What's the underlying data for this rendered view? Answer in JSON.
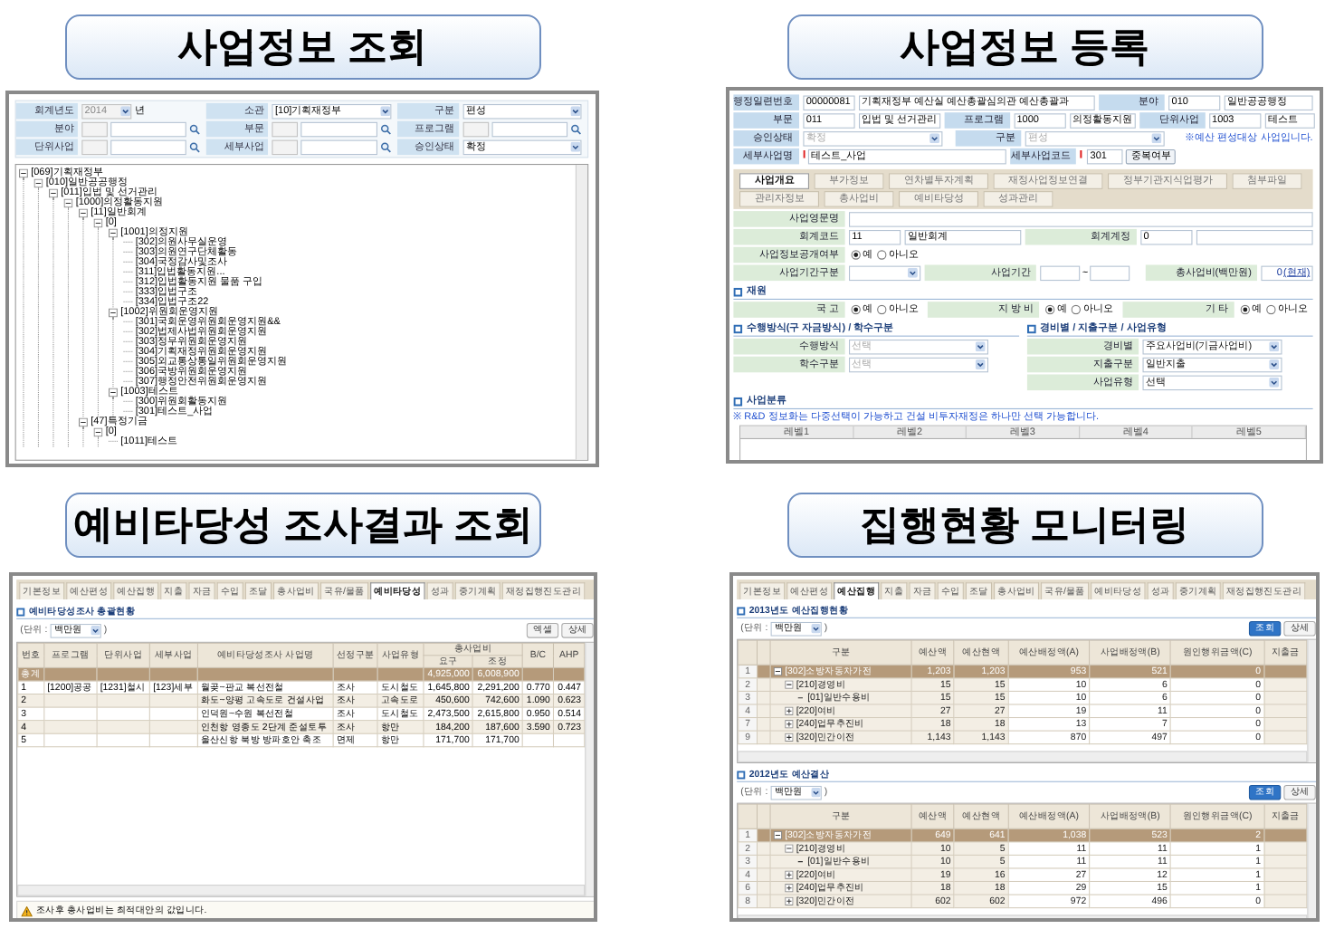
{
  "search_panel": {
    "title": "사업정보 조회",
    "fields": [
      {
        "kind": "year",
        "label": "회계년도",
        "value": "2014",
        "suffix": "년",
        "disabled": true
      },
      {
        "kind": "select",
        "label": "소관",
        "value": "[10]기획재정부"
      },
      {
        "kind": "select",
        "label": "구분",
        "value": "편성"
      },
      {
        "kind": "lookup",
        "label": "분야"
      },
      {
        "kind": "lookup",
        "label": "부문"
      },
      {
        "kind": "lookup",
        "label": "프로그램"
      },
      {
        "kind": "lookup",
        "label": "단위사업"
      },
      {
        "kind": "lookup",
        "label": "세부사업"
      },
      {
        "kind": "select",
        "label": "승인상태",
        "value": "확정"
      }
    ],
    "tree": [
      {
        "label": "[069]기획재정부",
        "children": [
          {
            "label": "[010]일반공공행정",
            "children": [
              {
                "label": "[011]입법 및 선거관리",
                "children": [
                  {
                    "label": "[1000]의정활동지원",
                    "children": [
                      {
                        "label": "[11]일반회계",
                        "children": [
                          {
                            "label": "[0]",
                            "children": [
                              {
                                "label": "[1001]의정지원",
                                "children": [
                                  {
                                    "label": "[302]의원사무실운영"
                                  },
                                  {
                                    "label": "[303]의원연구단체활동"
                                  },
                                  {
                                    "label": "[304]국정감사및조사"
                                  },
                                  {
                                    "label": "[311]입법활동지원..."
                                  },
                                  {
                                    "label": "[312]입법활동지원 물품 구입"
                                  },
                                  {
                                    "label": "[333]입법구조"
                                  },
                                  {
                                    "label": "[334]입법구조22"
                                  }
                                ]
                              },
                              {
                                "label": "[1002]위원회운영지원",
                                "children": [
                                  {
                                    "label": "[301]국회운영위원회운영지원&&"
                                  },
                                  {
                                    "label": "[302]법제사법위원회운영지원"
                                  },
                                  {
                                    "label": "[303]정무위원회운영지원"
                                  },
                                  {
                                    "label": "[304]기획재정위원회운영지원"
                                  },
                                  {
                                    "label": "[305]외교통상통일위원회운영지원"
                                  },
                                  {
                                    "label": "[306]국방위원회운영지원"
                                  },
                                  {
                                    "label": "[307]행정안전위원회운영지원"
                                  }
                                ]
                              },
                              {
                                "label": "[1003]테스트",
                                "children": [
                                  {
                                    "label": "[300]위원회활동지원"
                                  },
                                  {
                                    "label": "[301]테스트_사업"
                                  }
                                ]
                              }
                            ]
                          }
                        ]
                      },
                      {
                        "label": "[47]특정기금",
                        "children": [
                          {
                            "label": "[0]",
                            "children": [
                              {
                                "label": "[1011]테스트"
                              }
                            ]
                          }
                        ]
                      }
                    ]
                  }
                ]
              }
            ]
          }
        ]
      }
    ]
  },
  "register_panel": {
    "title": "사업정보 등록",
    "header_rows": [
      [
        {
          "kind": "code",
          "label": "행정일련번호",
          "code": "00000081",
          "value": "기획재정부 예산실 예산총괄심의관 예산총괄과"
        },
        {
          "kind": "code",
          "label": "분야",
          "code": "010",
          "value": "일반공공행정"
        }
      ],
      [
        {
          "kind": "code",
          "label": "부문",
          "code": "011",
          "value": "입법 및 선거관리"
        },
        {
          "kind": "code",
          "label": "프로그램",
          "code": "1000",
          "value": "의정활동지원"
        },
        {
          "kind": "code",
          "label": "단위사업",
          "code": "1003",
          "value": "테스트"
        }
      ],
      [
        {
          "kind": "select",
          "label": "승인상태",
          "value": "확정",
          "disabled": true
        },
        {
          "kind": "select",
          "label": "구분",
          "value": "편성",
          "disabled": true
        },
        {
          "kind": "note",
          "value": "※예산 편성대상 사업입니다."
        }
      ],
      [
        {
          "kind": "text",
          "label": "세부사업명",
          "value": "테스트_사업",
          "required": true
        },
        {
          "kind": "code_button",
          "label": "세부사업코드",
          "code": "301",
          "button": "중복여부",
          "required": true
        }
      ]
    ],
    "tabs": [
      {
        "label": "사업개요",
        "selected": true
      },
      {
        "label": "부가정보",
        "selected": false
      },
      {
        "label": "연차별투자계획",
        "selected": false
      },
      {
        "label": "재정사업정보연결",
        "selected": false
      },
      {
        "label": "정부기관지식업평가",
        "selected": false
      },
      {
        "label": "첨부파일",
        "selected": false
      },
      {
        "label": "관리자정보",
        "selected": false
      },
      {
        "label": "총사업비",
        "selected": false
      },
      {
        "label": "예비타당성",
        "selected": false
      },
      {
        "label": "성과관리",
        "selected": false
      }
    ],
    "form_rows": [
      [
        {
          "kind": "text",
          "label": "사업영문명"
        }
      ],
      [
        {
          "kind": "code",
          "label": "회계코드",
          "code": "11",
          "value": "일반회계"
        },
        {
          "kind": "code",
          "label": "회계계정",
          "code": "0"
        }
      ],
      [
        {
          "kind": "radio",
          "label": "사업정보공개여부",
          "options": [
            {
              "label": "예",
              "selected": true
            },
            {
              "label": "아니오",
              "selected": false
            }
          ]
        }
      ],
      [
        {
          "kind": "select",
          "label": "사업기간구분"
        },
        {
          "kind": "range",
          "label": "사업기간",
          "separator": "~"
        },
        {
          "kind": "amount",
          "label": "총사업비(백만원)",
          "value": "0",
          "link": "(현재)"
        }
      ]
    ],
    "funding": {
      "title": "재원",
      "fields": [
        {
          "kind": "radio",
          "label": "국 고",
          "options": [
            {
              "label": "예",
              "selected": true
            },
            {
              "label": "아니오",
              "selected": false
            }
          ]
        },
        {
          "kind": "radio",
          "label": "지 방 비",
          "options": [
            {
              "label": "예",
              "selected": true
            },
            {
              "label": "아니오",
              "selected": false
            }
          ]
        },
        {
          "kind": "radio",
          "label": "기 타",
          "options": [
            {
              "label": "예",
              "selected": true
            },
            {
              "label": "아니오",
              "selected": false
            }
          ]
        }
      ]
    },
    "split_sections": [
      {
        "title": "수행방식(구 자금방식) / 학수구분",
        "fields": [
          {
            "kind": "select",
            "label": "수행방식",
            "value": "선택",
            "disabled": true
          },
          {
            "kind": "select",
            "label": "학수구분",
            "value": "선택",
            "disabled": true
          }
        ]
      },
      {
        "title": "경비별 / 지출구분 / 사업유형",
        "fields": [
          {
            "kind": "select",
            "label": "경비별",
            "value": "주요사업비(기금사업비)",
            "disabled": false
          },
          {
            "kind": "select",
            "label": "지출구분",
            "value": "일반지출",
            "disabled": false
          },
          {
            "kind": "select",
            "label": "사업유형",
            "value": "선택",
            "disabled": false
          }
        ]
      }
    ],
    "classification": {
      "title": "사업분류",
      "note": "※ R&D 정보화는 다중선택이 가능하고 건설 비투자재정은 하나만 선택 가능합니다.",
      "columns": [
        "레벨1",
        "레벨2",
        "레벨3",
        "레벨4",
        "레벨5"
      ]
    }
  },
  "feasibility_panel": {
    "title": "예비타당성 조사결과 조회",
    "tabs": [
      {
        "label": "기본정보",
        "selected": false
      },
      {
        "label": "예산편성",
        "selected": false
      },
      {
        "label": "예산집행",
        "selected": false
      },
      {
        "label": "지출",
        "selected": false
      },
      {
        "label": "자금",
        "selected": false
      },
      {
        "label": "수입",
        "selected": false
      },
      {
        "label": "조달",
        "selected": false
      },
      {
        "label": "총사업비",
        "selected": false
      },
      {
        "label": "국유/물품",
        "selected": false
      },
      {
        "label": "예비타당성",
        "selected": true
      },
      {
        "label": "성과",
        "selected": false
      },
      {
        "label": "중기계획",
        "selected": false
      },
      {
        "label": "재정집행진도관리",
        "selected": false
      }
    ],
    "section_title": "예비타당성조사 총괄현황",
    "unit_open": "(단위 :",
    "unit": "백만원",
    "unit_close": ")",
    "buttons": [
      "엑셀",
      "상세"
    ],
    "columns": [
      "번호",
      "프로그램",
      "단위사업",
      "세부사업",
      "예비타당성조사 사업명",
      "선정구분",
      "사업유형",
      "총사업비",
      "B/C",
      "AHP"
    ],
    "subcolumns": [
      "요구",
      "조정"
    ],
    "rows": [
      {
        "kind": "total",
        "no": "총계",
        "request": "4,925,000",
        "adjusted": "6,008,900"
      },
      {
        "kind": "data",
        "no": "1",
        "program": "[1200]공공",
        "unit": "[1231]철시",
        "detail": "[123]세부",
        "name": "월곶~판교 복선전철",
        "type": "조사",
        "category": "도시철도",
        "request": "1,645,800",
        "adjusted": "2,291,200",
        "bc": "0.770",
        "ahp": "0.447"
      },
      {
        "kind": "data",
        "no": "2",
        "name": "화도~양평 고속도로 건설사업",
        "type": "조사",
        "category": "고속도로",
        "request": "450,600",
        "adjusted": "742,600",
        "bc": "1.090",
        "ahp": "0.623"
      },
      {
        "kind": "data",
        "no": "3",
        "name": "인덕원~수원 복선전철",
        "type": "조사",
        "category": "도시철도",
        "request": "2,473,500",
        "adjusted": "2,615,800",
        "bc": "0.950",
        "ahp": "0.514"
      },
      {
        "kind": "data",
        "no": "4",
        "name": "인천항 영종도 2단계 준설토투",
        "type": "조사",
        "category": "항만",
        "request": "184,200",
        "adjusted": "187,600",
        "bc": "3.590",
        "ahp": "0.723"
      },
      {
        "kind": "data",
        "no": "5",
        "name": "울산신항 북방 방파호안 축조",
        "type": "면제",
        "category": "항만",
        "request": "171,700",
        "adjusted": "171,700"
      }
    ],
    "footer": "조사후 총사업비는 최적대안의 값입니다."
  },
  "execution_panel": {
    "title": "집행현황 모니터링",
    "tabs": [
      {
        "label": "기본정보",
        "selected": false
      },
      {
        "label": "예산편성",
        "selected": false
      },
      {
        "label": "예산집행",
        "selected": true
      },
      {
        "label": "지출",
        "selected": false
      },
      {
        "label": "자금",
        "selected": false
      },
      {
        "label": "수입",
        "selected": false
      },
      {
        "label": "조달",
        "selected": false
      },
      {
        "label": "총사업비",
        "selected": false
      },
      {
        "label": "국유/물품",
        "selected": false
      },
      {
        "label": "예비타당성",
        "selected": false
      },
      {
        "label": "성과",
        "selected": false
      },
      {
        "label": "중기계획",
        "selected": false
      },
      {
        "label": "재정집행진도관리",
        "selected": false
      }
    ],
    "sections": [
      {
        "title": "2013년도 예산집행현황",
        "unit_open": "(단위 :",
        "unit": "백만원",
        "unit_close": ")",
        "buttons": [
          "조회",
          "상세"
        ],
        "columns": [
          "구분",
          "예산액",
          "예산현액",
          "예산배정액(A)",
          "사업배정액(B)",
          "원인행위금액(C)",
          "지출금"
        ],
        "rows": [
          {
            "no": "1",
            "kind": "collapse",
            "name": "[302]소방자동차가전",
            "values": [
              "1,203",
              "1,203",
              "953",
              "521",
              "0"
            ],
            "selected": true
          },
          {
            "no": "2",
            "kind": "collapse",
            "name": "[210]경영비",
            "values": [
              "15",
              "15",
              "10",
              "6",
              "0"
            ],
            "selected": false
          },
          {
            "no": "3",
            "kind": "leaf",
            "name": "[01]일반수용비",
            "values": [
              "15",
              "15",
              "10",
              "6",
              "0"
            ],
            "selected": false
          },
          {
            "no": "4",
            "kind": "expand",
            "name": "[220]여비",
            "values": [
              "27",
              "27",
              "19",
              "11",
              "0"
            ],
            "selected": false
          },
          {
            "no": "7",
            "kind": "expand",
            "name": "[240]업무추진비",
            "values": [
              "18",
              "18",
              "13",
              "7",
              "0"
            ],
            "selected": false
          },
          {
            "no": "9",
            "kind": "expand",
            "name": "[320]민간이전",
            "values": [
              "1,143",
              "1,143",
              "870",
              "497",
              "0"
            ],
            "selected": false
          }
        ]
      },
      {
        "title": "2012년도 예산결산",
        "unit_open": "(단위 :",
        "unit": "백만원",
        "unit_close": ")",
        "buttons": [
          "조회",
          "상세"
        ],
        "columns": [
          "구분",
          "예산액",
          "예산현액",
          "예산배정액(A)",
          "사업배정액(B)",
          "원인행위금액(C)",
          "지출금"
        ],
        "rows": [
          {
            "no": "1",
            "kind": "collapse",
            "name": "[302]소방자동차가전",
            "values": [
              "649",
              "641",
              "1,038",
              "523",
              "2"
            ],
            "selected": true
          },
          {
            "no": "2",
            "kind": "collapse",
            "name": "[210]경영비",
            "values": [
              "10",
              "5",
              "11",
              "11",
              "1"
            ],
            "selected": false
          },
          {
            "no": "3",
            "kind": "leaf",
            "name": "[01]일반수용비",
            "values": [
              "10",
              "5",
              "11",
              "11",
              "1"
            ],
            "selected": false
          },
          {
            "no": "4",
            "kind": "expand",
            "name": "[220]여비",
            "values": [
              "19",
              "16",
              "27",
              "12",
              "1"
            ],
            "selected": false
          },
          {
            "no": "6",
            "kind": "expand",
            "name": "[240]업무추진비",
            "values": [
              "18",
              "18",
              "29",
              "15",
              "1"
            ],
            "selected": false
          },
          {
            "no": "8",
            "kind": "expand",
            "name": "[320]민간이전",
            "values": [
              "602",
              "602",
              "972",
              "496",
              "0"
            ],
            "selected": false
          }
        ]
      }
    ]
  }
}
